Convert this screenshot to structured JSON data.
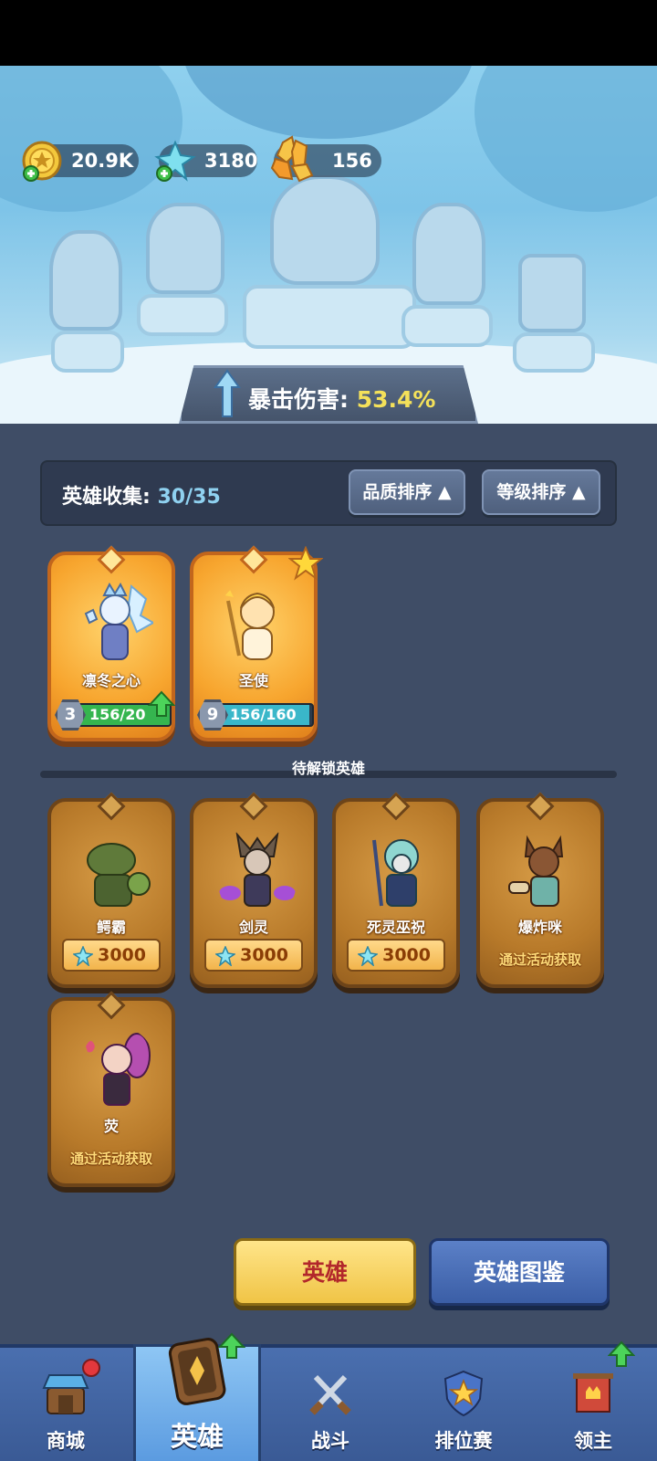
{
  "resources": {
    "gold": "20.9K",
    "crystal": "3180",
    "amber": "156"
  },
  "crit": {
    "label": "暴击伤害:",
    "value": "53.4%"
  },
  "collection": {
    "label": "英雄收集:",
    "count": "30/35",
    "sort_quality": "品质排序",
    "sort_level": "等级排序"
  },
  "owned_heroes": [
    {
      "name": "凛冬之心",
      "level": "3",
      "progress_text": "156/20",
      "progress": 1.0,
      "bar_color": "#35b54f",
      "upgrade": true
    },
    {
      "name": "圣使",
      "level": "9",
      "progress_text": "156/160",
      "progress": 0.975,
      "bar_color": "#3ab7c9",
      "star": true
    }
  ],
  "locked_label": "待解锁英雄",
  "locked_heroes": [
    {
      "name": "鳄霸",
      "cost": "3000"
    },
    {
      "name": "剑灵",
      "cost": "3000"
    },
    {
      "name": "死灵巫祝",
      "cost": "3000"
    },
    {
      "name": "爆炸咪",
      "event": "通过活动获取"
    },
    {
      "name": "荧",
      "event": "通过活动获取"
    }
  ],
  "buttons": {
    "heroes": "英雄",
    "codex": "英雄图鉴"
  },
  "nav": [
    {
      "label": "商城",
      "icon": "shop-icon"
    },
    {
      "label": "英雄",
      "icon": "hero-card-icon"
    },
    {
      "label": "战斗",
      "icon": "swords-icon"
    },
    {
      "label": "排位赛",
      "icon": "rank-shield-icon"
    },
    {
      "label": "领主",
      "icon": "lord-banner-icon"
    }
  ]
}
